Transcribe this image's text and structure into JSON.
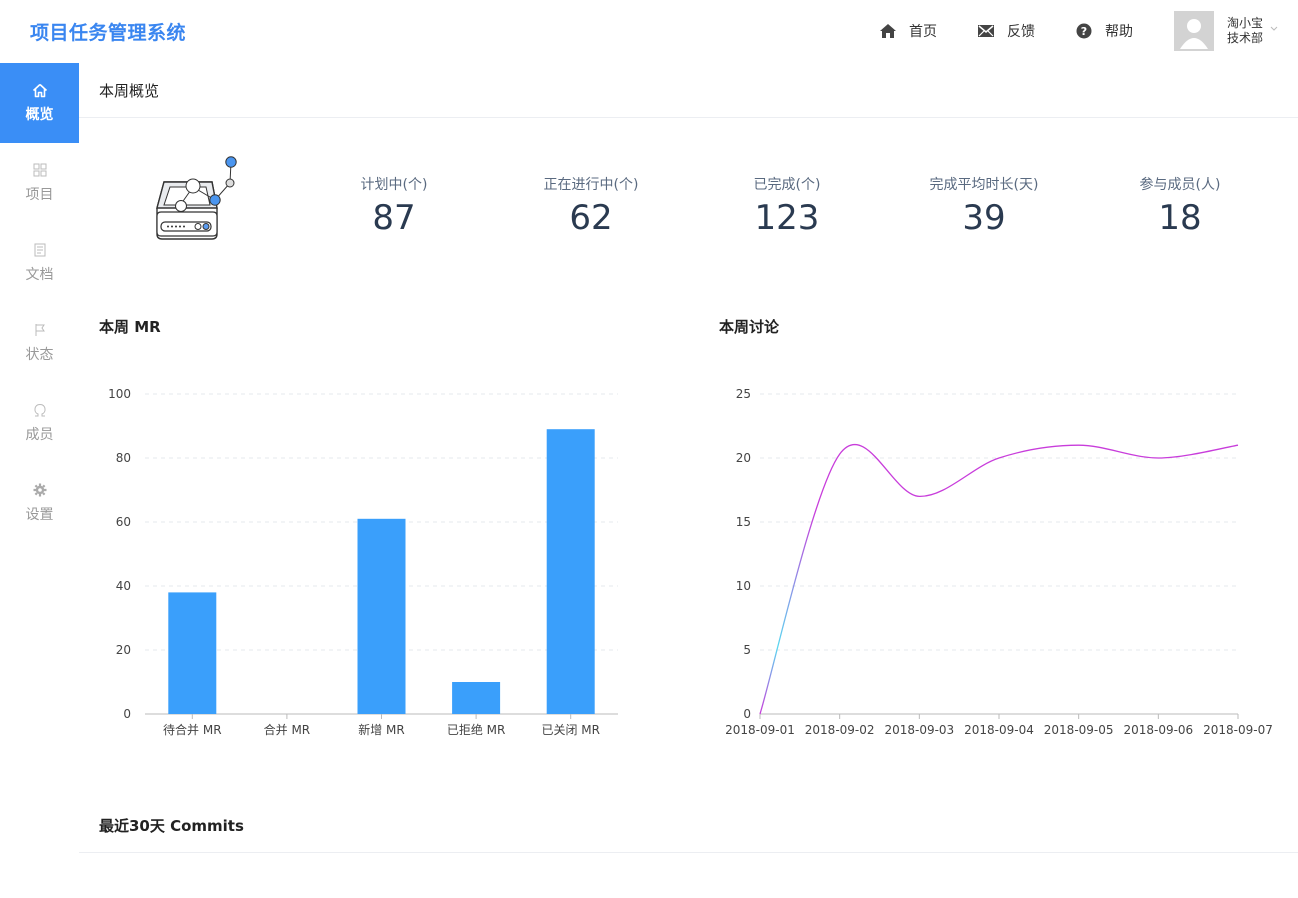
{
  "header": {
    "app_title": "项目任务管理系统",
    "nav": {
      "home": "首页",
      "feedback": "反馈",
      "help": "帮助"
    },
    "user": {
      "name": "淘小宝",
      "department": "技术部"
    }
  },
  "sidebar": {
    "items": [
      {
        "label": "概览",
        "icon": "home-icon",
        "active": true
      },
      {
        "label": "项目",
        "icon": "grid-icon",
        "active": false
      },
      {
        "label": "文档",
        "icon": "document-icon",
        "active": false
      },
      {
        "label": "状态",
        "icon": "flag-icon",
        "active": false
      },
      {
        "label": "成员",
        "icon": "member-icon",
        "active": false
      },
      {
        "label": "设置",
        "icon": "gear-icon",
        "active": false
      }
    ]
  },
  "overview": {
    "title": "本周概览",
    "stats": [
      {
        "label": "计划中(个)",
        "value": "87"
      },
      {
        "label": "正在进行中(个)",
        "value": "62"
      },
      {
        "label": "已完成(个)",
        "value": "123"
      },
      {
        "label": "完成平均时长(天)",
        "value": "39"
      },
      {
        "label": "参与成员(人)",
        "value": "18"
      }
    ]
  },
  "sections": {
    "mr_title": "本周 MR",
    "discussion_title": "本周讨论",
    "commits_title": "最近30天 Commits"
  },
  "colors": {
    "accent": "#3a8ef6",
    "bar": "#3a9ffb",
    "line_start": "#5ad8f0",
    "line_end": "#c83ddb"
  },
  "chart_data": [
    {
      "type": "bar",
      "title": "本周 MR",
      "categories": [
        "待合并 MR",
        "合并 MR",
        "新增 MR",
        "已拒绝 MR",
        "已关闭 MR"
      ],
      "values": [
        38,
        0,
        61,
        10,
        89
      ],
      "ylim": [
        0,
        100
      ],
      "yticks": [
        "0",
        "20",
        "40",
        "60",
        "80",
        "100"
      ],
      "grid": true
    },
    {
      "type": "line",
      "title": "本周讨论",
      "x": [
        "2018-09-01",
        "2018-09-02",
        "2018-09-03",
        "2018-09-04",
        "2018-09-05",
        "2018-09-06",
        "2018-09-07"
      ],
      "values": [
        0,
        20.3,
        17,
        20,
        21,
        20,
        21
      ],
      "ylim": [
        0,
        25
      ],
      "yticks": [
        "0",
        "5",
        "10",
        "15",
        "20",
        "25"
      ],
      "grid": true
    }
  ]
}
